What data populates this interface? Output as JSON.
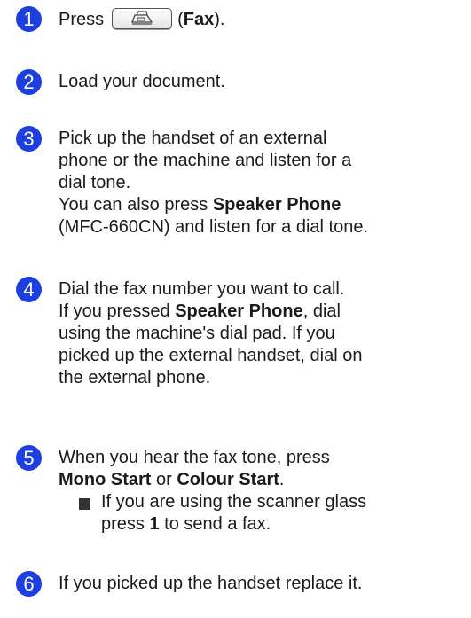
{
  "steps": [
    {
      "number": "1",
      "lines": {
        "a": "Press",
        "b": "(",
        "c": "Fax",
        "d": ")."
      }
    },
    {
      "number": "2",
      "lines": {
        "a": "Load your document."
      }
    },
    {
      "number": "3",
      "lines": {
        "a": "Pick up the handset of an external",
        "b": "phone or the machine and listen for a",
        "c": "dial tone.",
        "d": "You can also press ",
        "e": "Speaker Phone",
        "f": "(MFC-660CN) and listen for a dial tone."
      }
    },
    {
      "number": "4",
      "lines": {
        "a": "Dial the fax number you want to call.",
        "b": "If you pressed ",
        "c": "Speaker Phone",
        "d": ", dial",
        "e": "using the machine's dial pad. If you",
        "f": "picked up the external handset, dial on",
        "g": "the external phone."
      }
    },
    {
      "number": "5",
      "lines": {
        "a": "When you hear the fax tone, press",
        "b": "Mono Start",
        "c": " or ",
        "d": "Colour Start",
        "e": ".",
        "f": "If you are using the scanner glass",
        "g": "press ",
        "h": "1",
        "i": " to send a fax."
      }
    },
    {
      "number": "6",
      "lines": {
        "a": "If you picked up the handset replace it."
      }
    }
  ],
  "icons": {
    "fax_key": "fax-icon",
    "bullet": "square-bullet"
  },
  "colors": {
    "step_circle": "#1e3fe0"
  }
}
